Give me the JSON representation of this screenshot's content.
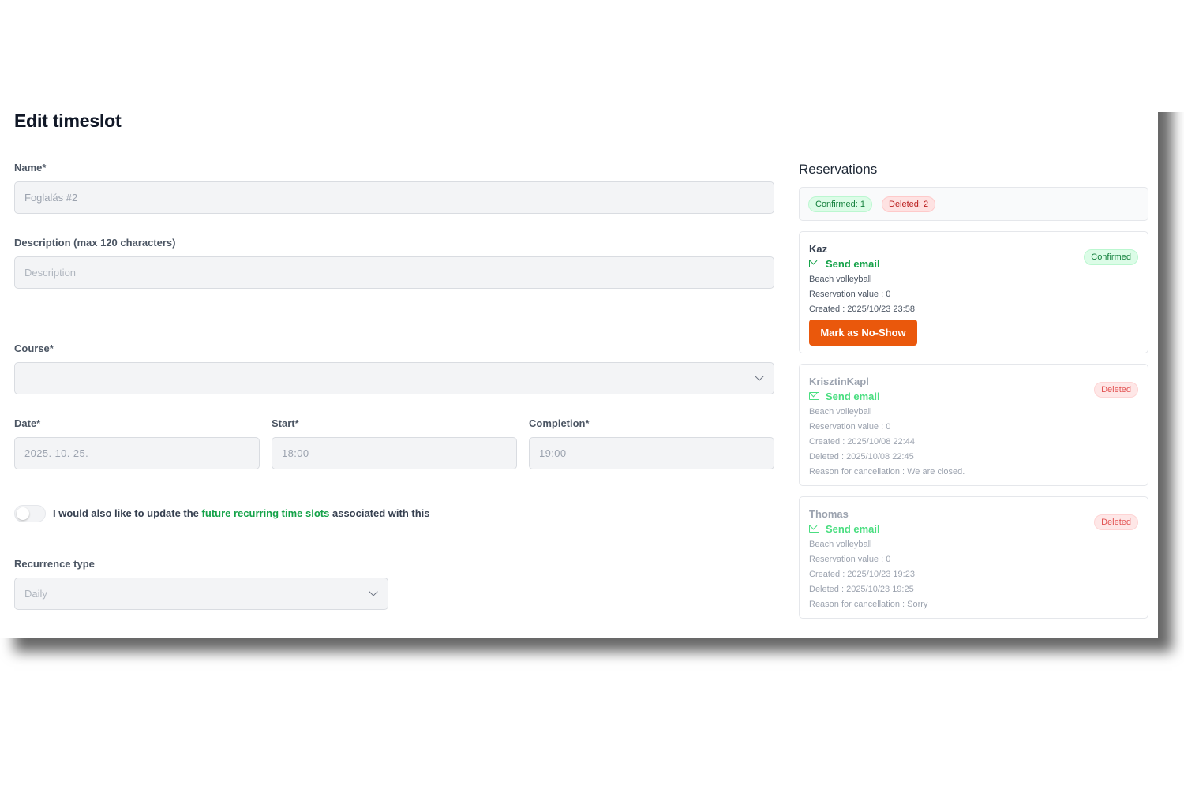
{
  "page_title": "Edit timeslot",
  "form": {
    "name_label": "Name*",
    "name_value": "Foglalás #2",
    "description_label": "Description (max 120 characters)",
    "description_placeholder": "Description",
    "course_label": "Course*",
    "course_value": "",
    "date_label": "Date*",
    "date_value": "2025. 10. 25.",
    "start_label": "Start*",
    "start_value": "18:00",
    "completion_label": "Completion*",
    "completion_value": "19:00",
    "toggle_text_before": "I would also like to update the",
    "toggle_link": "future recurring time slots",
    "toggle_text_after": "associated with this",
    "recurrence_label": "Recurrence type",
    "recurrence_value": "Daily"
  },
  "reservations": {
    "title": "Reservations",
    "summary": {
      "confirmed": "Confirmed: 1",
      "deleted": "Deleted: 2"
    },
    "items": [
      {
        "name": "Kaz",
        "send_email": "Send email",
        "status": "Confirmed",
        "course": "Beach volleyball",
        "value": "Reservation value : 0",
        "created": "Created : 2025/10/23 23:58",
        "no_show_button": "Mark as No-Show"
      },
      {
        "name": "KrisztinKapl",
        "send_email": "Send email",
        "status": "Deleted",
        "course": "Beach volleyball",
        "value": "Reservation value : 0",
        "created": "Created : 2025/10/08 22:44",
        "deleted": "Deleted : 2025/10/08 22:45",
        "reason": "Reason for cancellation : We are closed."
      },
      {
        "name": "Thomas",
        "send_email": "Send email",
        "status": "Deleted",
        "course": "Beach volleyball",
        "value": "Reservation value : 0",
        "created": "Created : 2025/10/23 19:23",
        "deleted": "Deleted : 2025/10/23 19:25",
        "reason": "Reason for cancellation : Sorry"
      }
    ]
  },
  "colors": {
    "accent_green": "#16a34a",
    "no_show_orange": "#ea580c",
    "deleted_red": "#dc2626"
  },
  "icons": {
    "send_email": "mail-icon",
    "select": "chevron-down-icon"
  }
}
